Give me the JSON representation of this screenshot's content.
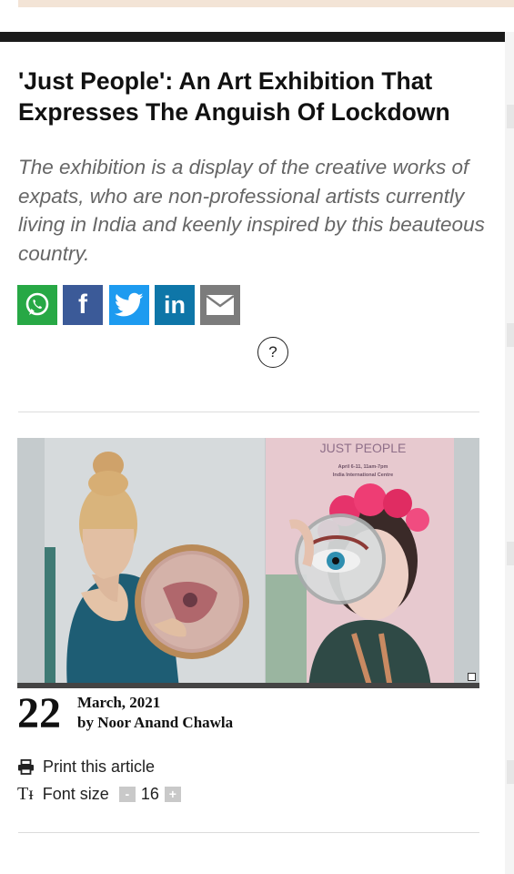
{
  "article": {
    "headline": "'Just People': An Art Exhibition That Expresses The Anguish Of Lockdown",
    "standfirst": "The exhibition is a display of the creative works of expats, who are non-professional artists currently living in India and keenly inspired by this beauteous country."
  },
  "share": {
    "help_symbol": "?",
    "buttons": [
      {
        "icon": "whatsapp-icon",
        "color": "#27a845"
      },
      {
        "icon": "facebook-icon",
        "color": "#3b5a98"
      },
      {
        "icon": "twitter-icon",
        "color": "#1d9bf0"
      },
      {
        "icon": "linkedin-icon",
        "color": "#0e76a8"
      },
      {
        "icon": "email-icon",
        "color": "#7c7c7c"
      }
    ]
  },
  "poster": {
    "title": "JUST PEOPLE",
    "dates": "April 6-11, 11am-7pm",
    "venue": "India International Centre"
  },
  "meta": {
    "day": "22",
    "month_year": "March, 2021",
    "byline": "by Noor Anand Chawla"
  },
  "tools": {
    "print_label": "Print this article",
    "font_icon": "Tᵻ",
    "font_label": "Font size",
    "font_minus": "-",
    "font_value": "16",
    "font_plus": "+"
  }
}
